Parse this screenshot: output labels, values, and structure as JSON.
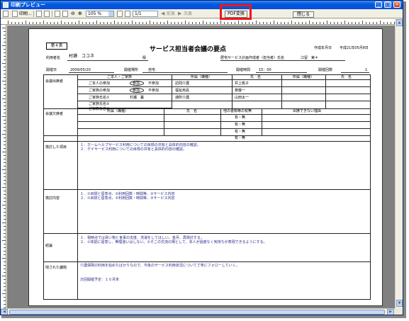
{
  "window": {
    "title": "印刷プレビュー"
  },
  "toolbar": {
    "print_label": "印刷...",
    "zoom_value": "105 %",
    "page_value": "1/1",
    "prev_label": "前頁",
    "next_label": "次頁",
    "pdf_label": "PDF変換",
    "close_label": "閉じる"
  },
  "document": {
    "table_number": "第４表",
    "title": "サービス担当者会議の要点",
    "created_label": "作成年月日",
    "created_date": "平成21年05月8日",
    "user_label": "利用者名",
    "user_name": "村瀬　ココネ",
    "honorific": "殿",
    "planner_label": "居宅サービス計画作成者（担当者）氏名",
    "planner_name": "江留　実＊",
    "held_date_label": "開催日",
    "held_date": "2009/05/20",
    "held_place_label": "開催場所",
    "held_place": "自宅",
    "held_time_label": "開催時間",
    "held_time": "15：00",
    "held_count_label": "開催回数",
    "held_count": "1",
    "attendees_label": "会議出席者",
    "family_header": "ご本人・ご家族",
    "family_rows": [
      {
        "label": "ご本人の参加",
        "attend": "参加",
        "absent": "不参加"
      },
      {
        "label": "ご家族の参加",
        "attend": "参加",
        "absent": "不参加"
      },
      {
        "label": "ご家族氏名①",
        "name": "村瀬　薫"
      },
      {
        "label": "ご家族氏名②",
        "name": ""
      },
      {
        "label": "ご家族氏名③",
        "name": ""
      }
    ],
    "affiliation_header": "所属（職種）",
    "name_header": "氏　名",
    "members": [
      {
        "affiliation": "訪問介護",
        "name": "井上桃子"
      },
      {
        "affiliation": "福祉用具",
        "name": "斉藤一"
      },
      {
        "affiliation": "通所介護",
        "name": "山田太一"
      }
    ],
    "absentees_label": "会議欠席者",
    "inquiry_header": "他の書類等の有無",
    "reason_header": "出席できない理由",
    "inquiry_values": [
      "有・無",
      "有・無",
      "有・無",
      "有・無"
    ],
    "review_label": "検討した項目",
    "review_items": [
      "１．ホームヘルプサービス利用についての目標の共有と具体的内容の確認。",
      "２．デイサービス利用についての目標の共有と具体的内容の確認。"
    ],
    "content_label": "検討内容",
    "content_items": [
      "１．①目標と留意点、②利用回数・時間等、③サービス内容",
      "２．①目標と留意点、②利用回数・時間等、③サービス内容"
    ],
    "conclusion_label": "結論",
    "conclusion_items": [
      "１．視時点では買い物と食事の支度、洗濯をしてほしい、金月、再検討する。",
      "２．①体調に留意し、無理強いはしない。②そこの交流の場として、本人が過度なく気持ちが表現できるようにする。"
    ],
    "issues_label": "残された課題",
    "issues_text": "介護保険の利用を始めたばかりなので、今後のサービス利用状況について丁寧にフォローしていく。",
    "next_meeting": "次回開催予定：１０月末"
  }
}
